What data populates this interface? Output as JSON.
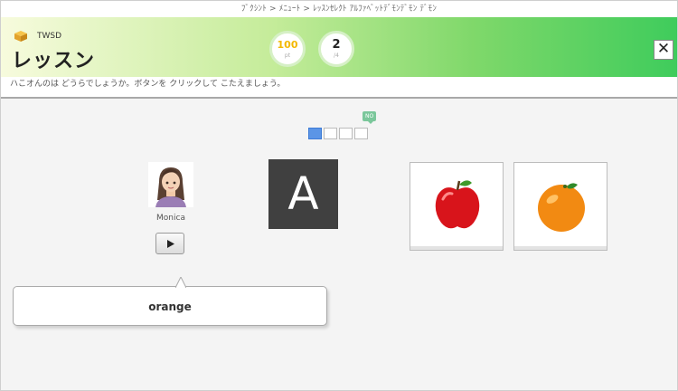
{
  "breadcrumb": "ﾌﾞｸｼﾝﾄ > ﾒﾆｭｰﾄ > ﾚｯｽﾝｾﾚｸﾄ  ｱﾙﾌｧﾍﾞｯﾄﾃﾞﾓﾝﾃﾞﾓﾝ ﾃﾞﾓﾝ",
  "header": {
    "course_label": "TWSD",
    "title": "レッスン",
    "score": {
      "value": "100",
      "sub": "pt"
    },
    "count": {
      "value": "2",
      "sub": "/4"
    },
    "close_label": "✕"
  },
  "instruction": "ハこオんのは どうらでしょうか。ボタンを クリックして こたえましょう。",
  "progress": {
    "badge": "NO",
    "total": 4,
    "current": 1
  },
  "speaker": {
    "name": "Monica",
    "play_icon": "play-icon"
  },
  "letter_card": "A",
  "choices": [
    {
      "name": "apple",
      "icon": "apple-icon"
    },
    {
      "name": "orange",
      "icon": "orange-icon"
    }
  ],
  "speech": "orange",
  "colors": {
    "header_gradient_start": "#f7fbdd",
    "header_gradient_end": "#3fcc5c",
    "progress_active": "#5b95e6",
    "score_color": "#f3b800",
    "letter_card_bg": "#404040"
  }
}
